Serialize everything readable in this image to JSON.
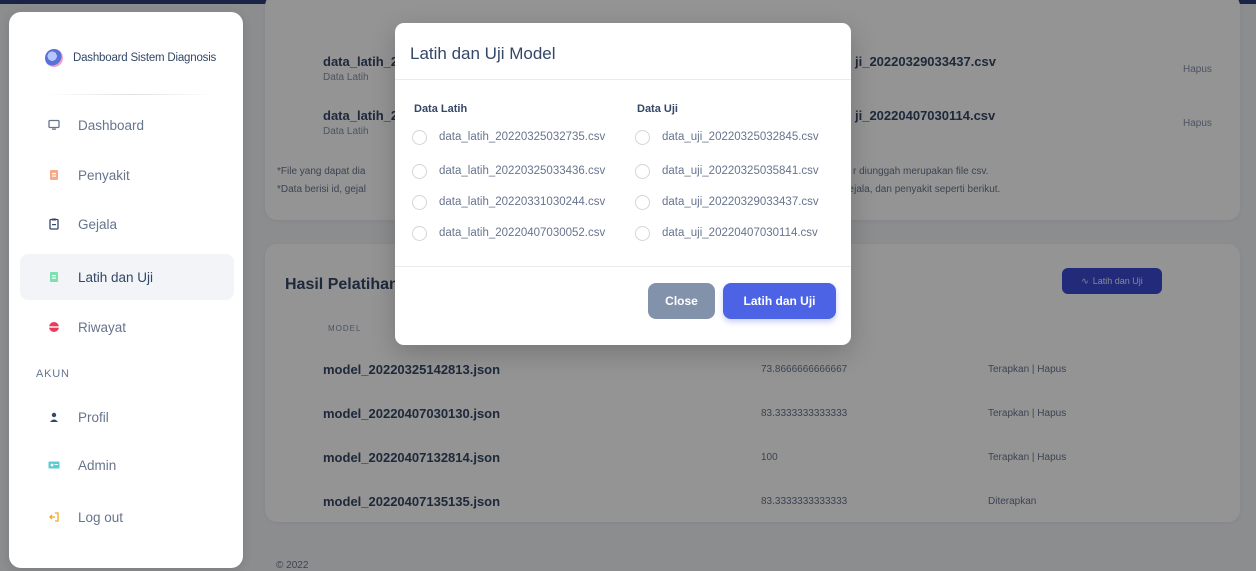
{
  "sidebar": {
    "brand": "Dashboard Sistem Diagnosis",
    "items": [
      {
        "label": "Dashboard",
        "icon": "monitor-icon"
      },
      {
        "label": "Penyakit",
        "icon": "file-icon"
      },
      {
        "label": "Gejala",
        "icon": "clipboard-icon"
      },
      {
        "label": "Latih dan Uji",
        "icon": "document-icon"
      },
      {
        "label": "Riwayat",
        "icon": "globe-icon"
      }
    ],
    "section_label": "AKUN",
    "account_items": [
      {
        "label": "Profil",
        "icon": "user-icon"
      },
      {
        "label": "Admin",
        "icon": "id-card-icon"
      },
      {
        "label": "Log out",
        "icon": "logout-icon"
      }
    ],
    "active_index": 3
  },
  "background": {
    "data_rows": [
      {
        "name": "data_latih_2",
        "sub": "Data Latih",
        "right": "ji_20220329033437.csv",
        "action": "Hapus"
      },
      {
        "name": "data_latih_2",
        "sub": "Data Latih",
        "right": "ji_20220407030114.csv",
        "action": "Hapus"
      }
    ],
    "note_left_1": "*File yang dapat dia",
    "note_left_2": "*Data berisi id, gejal",
    "note_right_1": "r diunggah merupakan file csv.",
    "note_right_2": "gejala, dan penyakit seperti berikut.",
    "results_title": "Hasil Pelatihan",
    "results_button": "Latih dan Uji",
    "column_header": "MODEL",
    "models": [
      {
        "name": "model_20220325142813.json",
        "accuracy": "73.8666666666667",
        "action": "Terapkan | Hapus"
      },
      {
        "name": "model_20220407030130.json",
        "accuracy": "83.3333333333333",
        "action": "Terapkan | Hapus"
      },
      {
        "name": "model_20220407132814.json",
        "accuracy": "100",
        "action": "Terapkan | Hapus"
      },
      {
        "name": "model_20220407135135.json",
        "accuracy": "83.3333333333333",
        "action": "Diterapkan"
      }
    ],
    "footer": "© 2022"
  },
  "modal": {
    "title": "Latih dan Uji Model",
    "train_header": "Data Latih",
    "test_header": "Data Uji",
    "train_options": [
      "data_latih_20220325032735.csv",
      "data_latih_20220325033436.csv",
      "data_latih_20220331030244.csv",
      "data_latih_20220407030052.csv"
    ],
    "test_options": [
      "data_uji_20220325032845.csv",
      "data_uji_20220325035841.csv",
      "data_uji_20220329033437.csv",
      "data_uji_20220407030114.csv"
    ],
    "close_label": "Close",
    "submit_label": "Latih dan Uji"
  },
  "colors": {
    "primary": "#4d63e6",
    "secondary": "#8392ab",
    "text": "#344767"
  }
}
